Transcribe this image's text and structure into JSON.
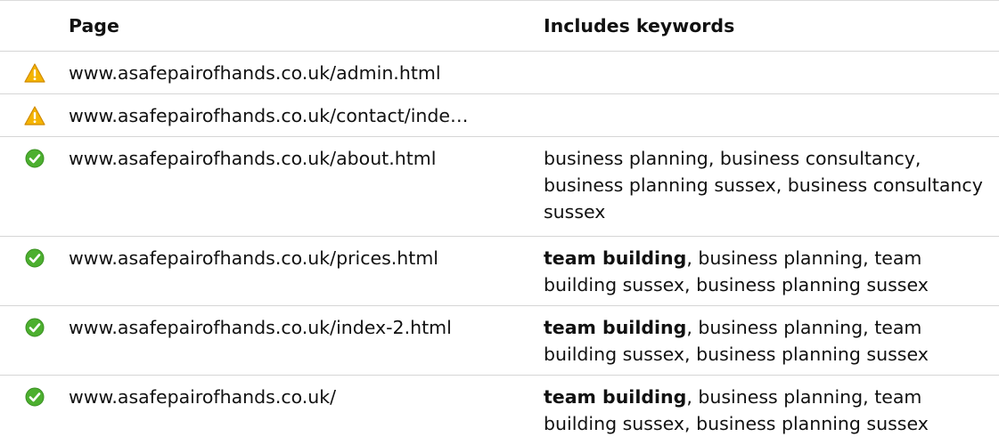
{
  "header": {
    "page_label": "Page",
    "keywords_label": "Includes keywords"
  },
  "colors": {
    "warning": "#f2b705",
    "success": "#4caf2f",
    "border": "#d6d6d6"
  },
  "rows": [
    {
      "status_icon": "warning-icon",
      "page": "www.asafepairofhands.co.uk/admin.html",
      "keywords_strong": "",
      "keywords_rest": ""
    },
    {
      "status_icon": "warning-icon",
      "page": "www.asafepairofhands.co.uk/contact/inde…",
      "keywords_strong": "",
      "keywords_rest": ""
    },
    {
      "status_icon": "check-circle-icon",
      "page": "www.asafepairofhands.co.uk/about.html",
      "keywords_strong": "",
      "keywords_rest": "business planning, business consultancy, business planning sussex, business consultancy sussex"
    },
    {
      "status_icon": "check-circle-icon",
      "page": "www.asafepairofhands.co.uk/prices.html",
      "keywords_strong": "team building",
      "keywords_rest": ", business planning, team building sussex, business planning sussex"
    },
    {
      "status_icon": "check-circle-icon",
      "page": "www.asafepairofhands.co.uk/index-2.html",
      "keywords_strong": "team building",
      "keywords_rest": ", business planning, team building sussex, business planning sussex"
    },
    {
      "status_icon": "check-circle-icon",
      "page": "www.asafepairofhands.co.uk/",
      "keywords_strong": "team building",
      "keywords_rest": ", business planning, team building sussex, business planning sussex"
    }
  ]
}
